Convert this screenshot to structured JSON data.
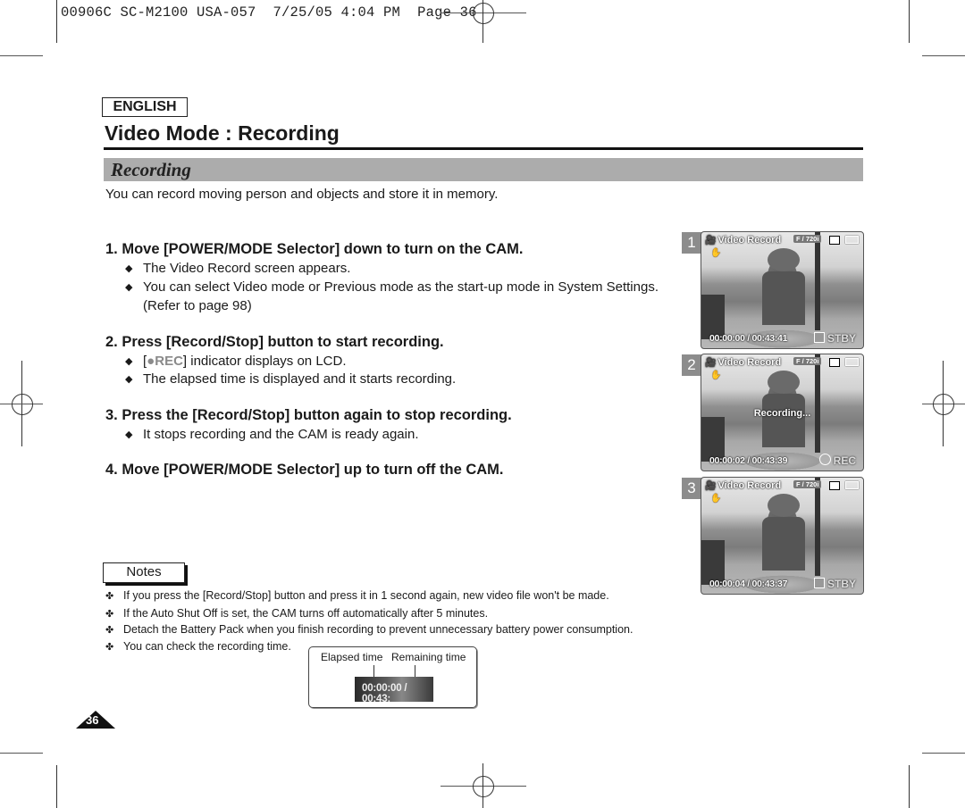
{
  "slug": "00906C SC-M2100 USA-057  7/25/05 4:04 PM  Page 36",
  "language": "ENGLISH",
  "title": "Video Mode : Recording",
  "section": "Recording",
  "intro": "You can record moving person and objects and store it in memory.",
  "steps": [
    {
      "text": "1.  Move [POWER/MODE Selector] down to turn on the CAM.",
      "bullets": [
        "The Video Record screen appears.",
        "You can select Video mode or Previous mode as the start-up mode in System Settings.",
        "(Refer to page 98)"
      ]
    },
    {
      "text": "2.  Press [Record/Stop] button to start recording.",
      "bullets": [
        "[",
        "REC",
        "] indicator displays on LCD.",
        "The elapsed time is displayed and it starts recording."
      ]
    },
    {
      "text": "3.  Press the [Record/Stop] button again to stop recording.",
      "bullets": [
        "It stops recording and the CAM is ready again."
      ]
    },
    {
      "text": "4.  Move [POWER/MODE Selector] up to turn off the CAM.",
      "bullets": []
    }
  ],
  "notes": {
    "label": "Notes",
    "items": [
      "If you press the [Record/Stop] button and press it in 1 second again, new video file won't be made.",
      "If the Auto Shut Off is set, the CAM turns off automatically after 5 minutes.",
      "Detach the Battery Pack when you finish recording to prevent unnecessary battery power consumption.",
      "You can check the recording time."
    ]
  },
  "time_diagram": {
    "elapsed_label": "Elapsed time",
    "remaining_label": "Remaining time",
    "readout": "00:00:00 / 00:43:"
  },
  "page_number": "36",
  "screens": [
    {
      "number": "1",
      "title": "Video Record",
      "resolution": "F / 720i",
      "time": "00:00:00 / 00:43:41",
      "status": "STBY",
      "status_icon": "stop-square-icon",
      "message": ""
    },
    {
      "number": "2",
      "title": "Video Record",
      "resolution": "F / 720i",
      "time": "00:00:02 / 00:43:39",
      "status": "REC",
      "status_icon": "record-circle-icon",
      "message": "Recording..."
    },
    {
      "number": "3",
      "title": "Video Record",
      "resolution": "F / 720i",
      "time": "00:00:04 / 00:43:37",
      "status": "STBY",
      "status_icon": "stop-square-icon",
      "message": ""
    }
  ]
}
